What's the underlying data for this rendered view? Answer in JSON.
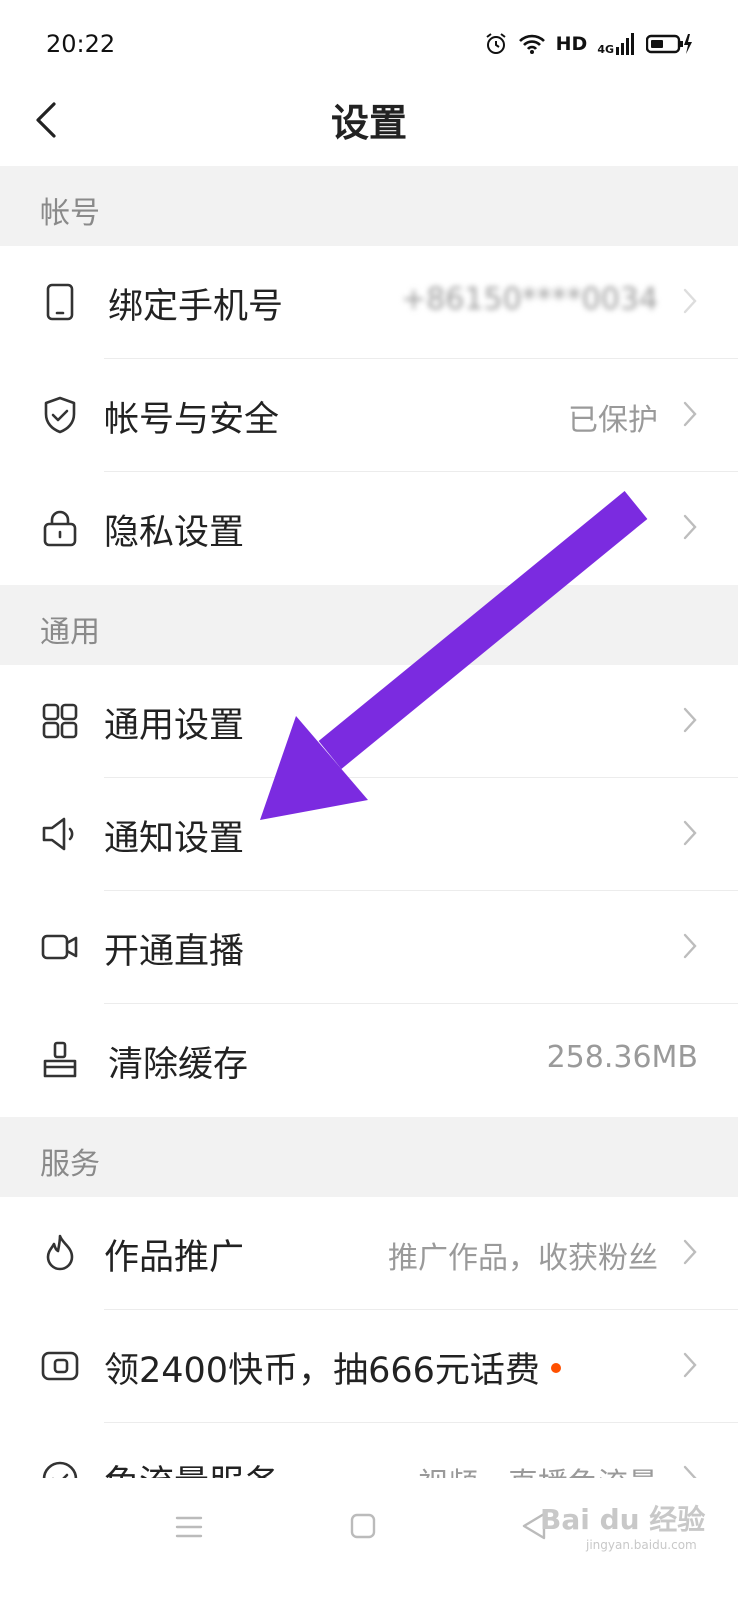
{
  "status": {
    "time": "20:22",
    "network_type": "HD",
    "signal_gen": "4G"
  },
  "header": {
    "title": "设置"
  },
  "sections": {
    "account": {
      "title": "帐号"
    },
    "general": {
      "title": "通用"
    },
    "services": {
      "title": "服务"
    }
  },
  "rows": {
    "bind_phone": {
      "label": "绑定手机号",
      "value": "+86150****0034",
      "icon": "phone-icon"
    },
    "account_security": {
      "label": "帐号与安全",
      "value": "已保护",
      "icon": "shield-icon"
    },
    "privacy": {
      "label": "隐私设置",
      "icon": "lock-icon"
    },
    "general_settings": {
      "label": "通用设置",
      "icon": "grid-icon"
    },
    "notification": {
      "label": "通知设置",
      "icon": "speaker-icon"
    },
    "live": {
      "label": "开通直播",
      "icon": "video-camera-icon"
    },
    "clear_cache": {
      "label": "清除缓存",
      "value": "258.36MB",
      "icon": "brush-icon"
    },
    "promotion": {
      "label": "作品推广",
      "value": "推广作品，收获粉丝",
      "icon": "flame-icon"
    },
    "coins": {
      "label": "领2400快币，抽666元话费",
      "icon": "wallet-icon"
    },
    "free_data": {
      "label": "免流量服务",
      "value": "视频、直播免流量",
      "icon": "check-circle-icon"
    }
  },
  "watermark": {
    "text": "Bai du 经验",
    "sub": "jingyan.baidu.com"
  },
  "colors": {
    "accent_arrow": "#7b2be0",
    "red_dot": "#ff5000",
    "section_bg": "#f2f2f2"
  }
}
